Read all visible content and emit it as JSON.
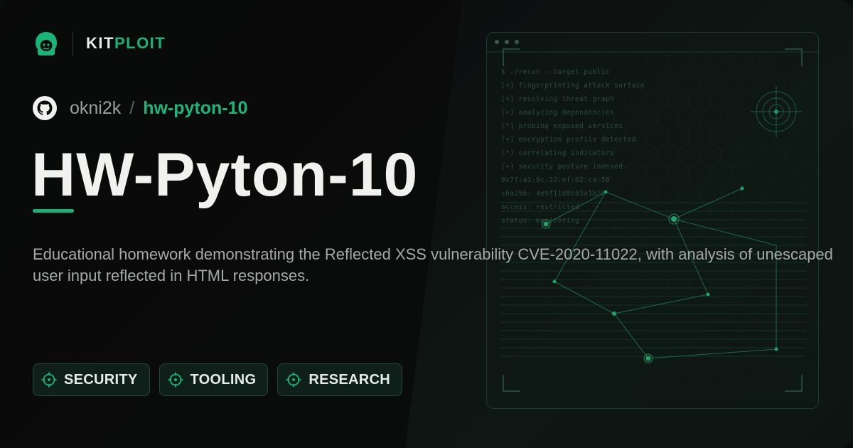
{
  "brand": {
    "prefix": "KIT",
    "suffix": "PLOIT",
    "logo_icon": "hacker-head-icon"
  },
  "repo": {
    "owner": "okni2k",
    "separator": "/",
    "name": "hw-pyton-10",
    "icon": "github-icon"
  },
  "title": "HW-Pyton-10",
  "description": "Educational homework demonstrating the Reflected XSS vulnerability CVE-2020-11022, with analysis of unescaped user input reflected in HTML responses.",
  "tags": [
    {
      "label": "SECURITY",
      "icon": "crosshair-icon"
    },
    {
      "label": "TOOLING",
      "icon": "crosshair-icon"
    },
    {
      "label": "RESEARCH",
      "icon": "crosshair-icon"
    }
  ],
  "terminal": {
    "lines": [
      "$ ./recon --target public",
      "[+] fingerprinting attack surface",
      "[+] resolving threat graph",
      "[+] analyzing dependencies",
      "[*] probing exposed services",
      "[+] encryption profile detected",
      "[*] correlating indicators",
      "[+] security posture indexed",
      "0x7f:a1:9c:22:ef:02:ca:58",
      "sha256: 4e9f11d8c03a1b2b",
      "access: restricted",
      "status: monitoring"
    ]
  },
  "colors": {
    "accent": "#18b477",
    "background": "#0b0d0c",
    "title": "#f1f2ef",
    "text_muted": "#a4aaa7"
  }
}
